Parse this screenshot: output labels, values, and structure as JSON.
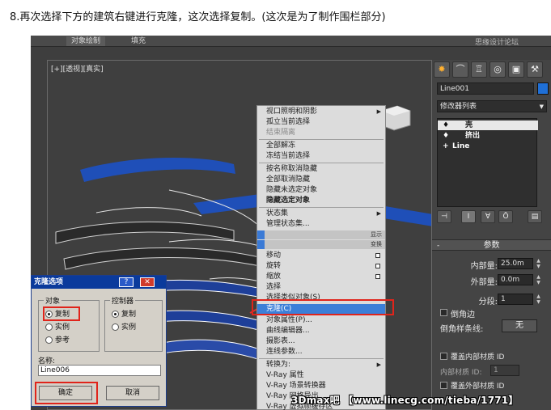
{
  "caption": "8.再次选择下方的建筑右键进行克隆，这次选择复制。(这次是为了制作围栏部分)",
  "topbar": {
    "tabs": [
      "对象绘制",
      "填充"
    ],
    "watermark": "思缘设计论坛"
  },
  "viewport": {
    "label": "[+][透视][真实]"
  },
  "context_menu": {
    "items": [
      {
        "label": "视口照明和阴影",
        "state": "normal",
        "submenu": true
      },
      {
        "label": "孤立当前选择",
        "state": "normal"
      },
      {
        "label": "结束隔离",
        "state": "disabled"
      },
      {
        "label": "全部解冻",
        "state": "normal"
      },
      {
        "label": "冻结当前选择",
        "state": "normal"
      },
      {
        "label": "按名称取消隐藏",
        "state": "normal"
      },
      {
        "label": "全部取消隐藏",
        "state": "normal"
      },
      {
        "label": "隐藏未选定对象",
        "state": "normal"
      },
      {
        "label": "隐藏选定对象",
        "state": "bold"
      },
      {
        "label": "状态集",
        "state": "normal",
        "submenu": true
      },
      {
        "label": "管理状态集...",
        "state": "normal"
      },
      {
        "label": "移动",
        "state": "normal"
      },
      {
        "label": "旋转",
        "state": "normal"
      },
      {
        "label": "缩放",
        "state": "normal"
      },
      {
        "label": "选择",
        "state": "normal"
      },
      {
        "label": "选择类似对象(S)",
        "state": "normal"
      },
      {
        "label": "克隆(C)",
        "state": "highlighted"
      },
      {
        "label": "对象属性(P)...",
        "state": "normal"
      },
      {
        "label": "曲线编辑器...",
        "state": "normal"
      },
      {
        "label": "摄影表...",
        "state": "normal"
      },
      {
        "label": "连线参数...",
        "state": "normal"
      },
      {
        "label": "转换为:",
        "state": "normal",
        "submenu": true
      },
      {
        "label": "V-Ray 属性",
        "state": "normal"
      },
      {
        "label": "V-Ray 场景转换器",
        "state": "normal"
      },
      {
        "label": "V-Ray 网格导出",
        "state": "normal"
      },
      {
        "label": "V-Ray 虚拟帧缓存区",
        "state": "normal"
      }
    ],
    "quad_labels": [
      "显示",
      "变换"
    ]
  },
  "panel": {
    "object_name": "Line001",
    "modifier_list": "修改器列表",
    "stack": [
      "壳",
      "挤出",
      "Line"
    ],
    "rollout_title": "参数",
    "params": [
      {
        "label": "内部量:",
        "value": "25.0m"
      },
      {
        "label": "外部量:",
        "value": "0.0m"
      },
      {
        "label": "分段:",
        "value": "1"
      }
    ],
    "bevel_edge": "倒角边",
    "bevel_spline_label": "倒角样条线:",
    "bevel_spline_value": "无",
    "override_inner": "覆盖内部材质 ID",
    "inner_mat_label": "内部材质 ID:",
    "inner_mat_value": "1",
    "override_outer": "覆盖外部材质 ID"
  },
  "dialog": {
    "title": "克隆选项",
    "help": "?",
    "close": "✕",
    "object_group": "对象",
    "object_options": [
      {
        "label": "复制",
        "checked": true
      },
      {
        "label": "实例",
        "checked": false
      },
      {
        "label": "参考",
        "checked": false
      }
    ],
    "controller_group": "控制器",
    "controller_options": [
      {
        "label": "复制",
        "checked": true
      },
      {
        "label": "实例",
        "checked": false
      }
    ],
    "name_label": "名称:",
    "name_value": "Line006",
    "ok": "确定",
    "cancel": "取消"
  },
  "footer_watermark": "3Dmax吧 【www.linecg.com/tieba/1771】",
  "colors": {
    "accent_red": "#e0241b",
    "menu_highlight": "#3c7fd8",
    "dialog_title": "#0a3a9c",
    "wireframe_blue": "#1f4fb8"
  }
}
